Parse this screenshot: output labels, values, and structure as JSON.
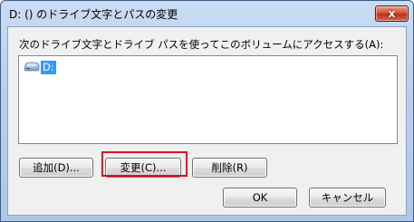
{
  "window": {
    "title": "D: () のドライブ文字とパスの変更",
    "close_label": "x"
  },
  "dialog": {
    "prompt": "次のドライブ文字とドライブ パスを使ってこのボリュームにアクセスする(A):",
    "list_items": [
      {
        "label": "D:",
        "icon": "drive-icon",
        "selected": true
      }
    ]
  },
  "buttons": {
    "add": "追加(D)...",
    "change": "変更(C)...",
    "remove": "削除(R)",
    "ok": "OK",
    "cancel": "キャンセル"
  },
  "colors": {
    "selection": "#3399ff",
    "highlight_box": "#e8001c"
  }
}
